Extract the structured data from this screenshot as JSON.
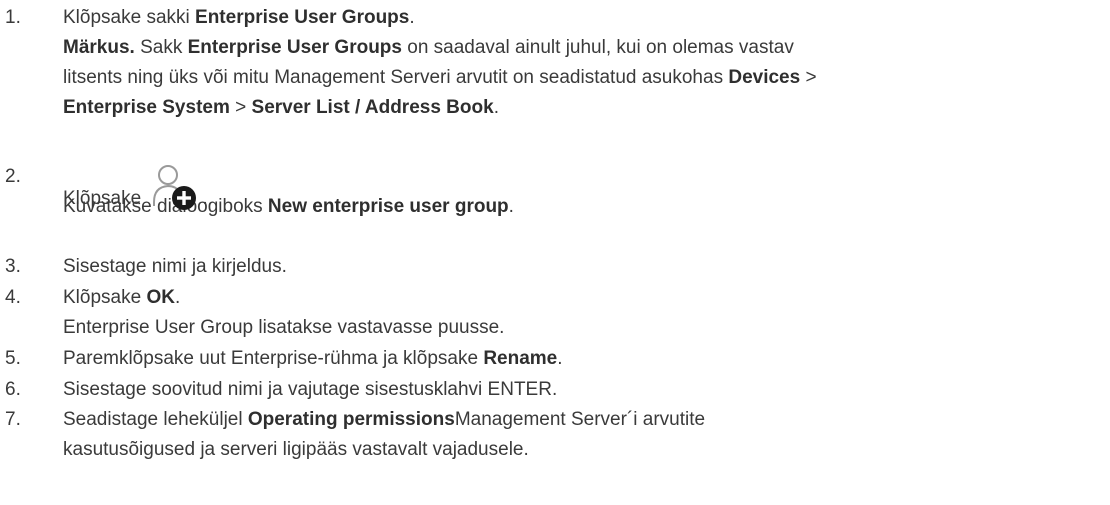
{
  "steps": [
    {
      "number": "1.",
      "line1": {
        "pre": "Klõpsake sakki ",
        "b1": "Enterprise User Groups",
        "post": "."
      },
      "note": {
        "label": "Märkus.",
        "t1": " Sakk ",
        "b1": "Enterprise User Groups",
        "t2": " on saadaval ainult juhul, kui on olemas vastav",
        "l2": "litsents ning üks või mitu Management Serveri arvutit on seadistatud asukohas ",
        "b2": "Devices",
        "t3": " >",
        "b3": "Enterprise System",
        "t4": " > ",
        "b4": "Server List / Address Book",
        "t5": "."
      }
    },
    {
      "number": "2.",
      "pre": "Klõpsake ",
      "icon": "add-user-icon",
      "post": ".",
      "sub": {
        "pre": "Kuvatakse dialoogiboks ",
        "b1": "New enterprise user group",
        "post": "."
      }
    },
    {
      "number": "3.",
      "text": "Sisestage nimi ja kirjeldus."
    },
    {
      "number": "4.",
      "pre": "Klõpsake ",
      "b1": "OK",
      "post": ".",
      "sub": "Enterprise User Group lisatakse vastavasse puusse."
    },
    {
      "number": "5.",
      "pre": "Paremklõpsake uut Enterprise-rühma ja klõpsake ",
      "b1": "Rename",
      "post": "."
    },
    {
      "number": "6.",
      "text": "Sisestage soovitud nimi ja vajutage sisestusklahvi ENTER."
    },
    {
      "number": "7.",
      "pre": "Seadistage leheküljel ",
      "b1": "Operating permissions",
      "post": "Management Server´i arvutite",
      "line2": "kasutusõigused ja serveri ligipääs vastavalt vajadusele."
    }
  ]
}
